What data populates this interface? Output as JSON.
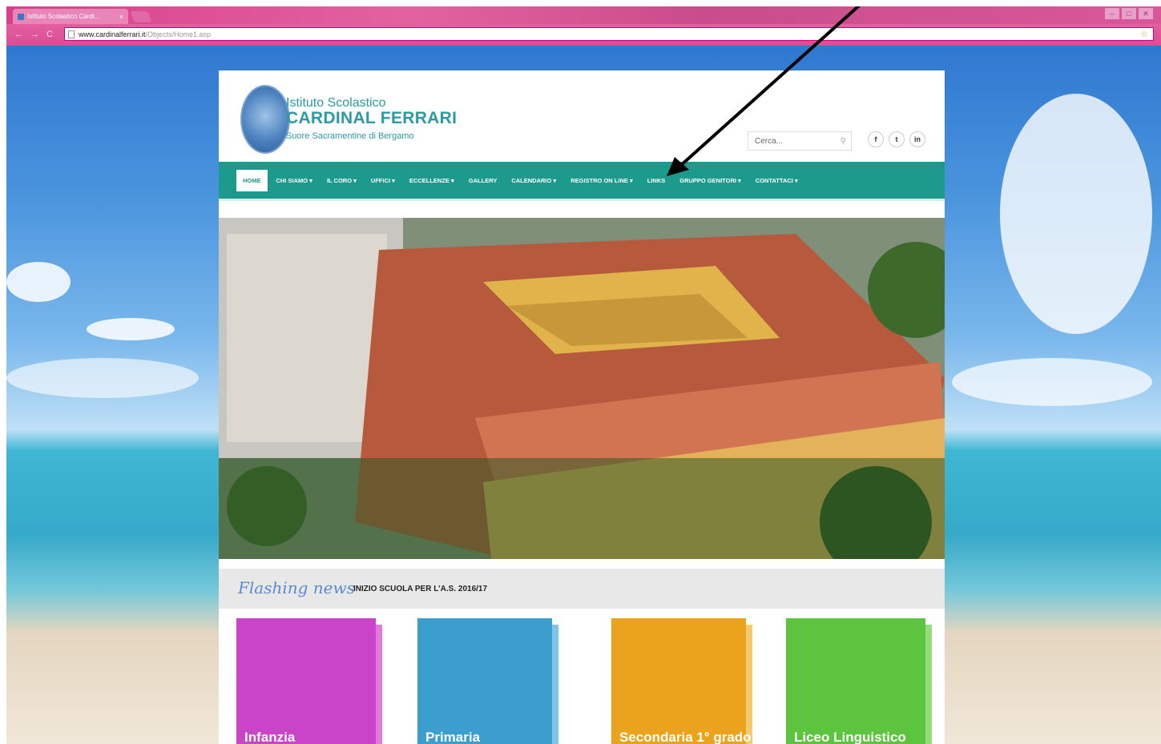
{
  "browser": {
    "tab_title": "Istituto Scolastico Cardi...",
    "tab_close": "×",
    "url_domain": "www.cardinalferrari.it",
    "url_path": "/Objects/Home1.asp",
    "accent": "#d94d94"
  },
  "site": {
    "logo_line1": "Istituto Scolastico",
    "logo_line2": "CARDINAL FERRARI",
    "logo_line3": "Suore Sacramentine di Bergamo",
    "search_placeholder": "Cerca...",
    "social": [
      "f",
      "t",
      "in"
    ],
    "brand_color": "#1c9b8c"
  },
  "nav": {
    "items": [
      {
        "label": "HOME",
        "dropdown": false,
        "active": true
      },
      {
        "label": "CHI SIAMO ▾",
        "dropdown": true
      },
      {
        "label": "IL CORO ▾",
        "dropdown": true
      },
      {
        "label": "UFFICI ▾",
        "dropdown": true
      },
      {
        "label": "ECCELLENZE ▾",
        "dropdown": true
      },
      {
        "label": "GALLERY",
        "dropdown": false
      },
      {
        "label": "CALENDARIO ▾",
        "dropdown": true
      },
      {
        "label": "REGISTRO ON LINE ▾",
        "dropdown": true
      },
      {
        "label": "LINKS",
        "dropdown": false
      },
      {
        "label": "GRUPPO GENITORI ▾",
        "dropdown": true
      },
      {
        "label": "CONTATTACI ▾",
        "dropdown": true
      }
    ]
  },
  "news": {
    "tag": "Flashing news",
    "text": "INIZIO SCUOLA PER L'A.S. 2016/17"
  },
  "cards": [
    {
      "label": "Infanzia",
      "color": "#c944c6"
    },
    {
      "label": "Primaria",
      "color": "#3c9ecf"
    },
    {
      "label": "Secondaria 1° grado",
      "color": "#eba21d"
    },
    {
      "label": "Liceo Linguistico",
      "color": "#5cc43f"
    }
  ]
}
